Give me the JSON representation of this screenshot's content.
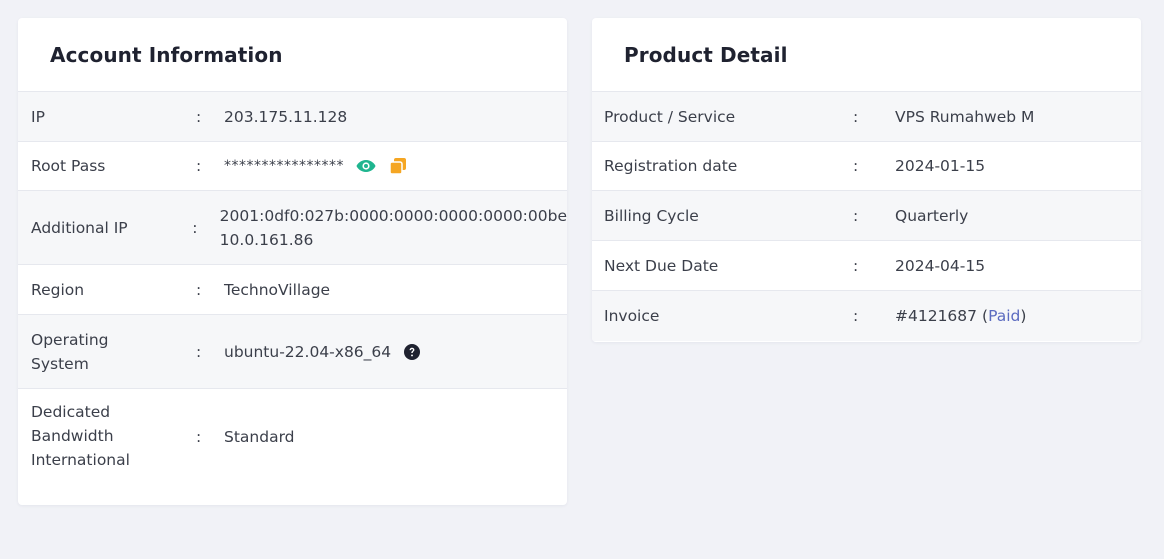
{
  "account": {
    "title": "Account Information",
    "rows": [
      {
        "label": "IP",
        "value": "203.175.11.128"
      },
      {
        "label": "Root Pass",
        "value": "****************"
      },
      {
        "label": "Additional IP",
        "value_lines": [
          "2001:0df0:027b:0000:0000:0000:0000:00be",
          "10.0.161.86"
        ]
      },
      {
        "label": "Region",
        "value": "TechnoVillage"
      },
      {
        "label_lines": [
          "Operating",
          "System"
        ],
        "value": "ubuntu-22.04-x86_64"
      },
      {
        "label_lines": [
          "Dedicated",
          "Bandwidth",
          "International"
        ],
        "value": "Standard"
      }
    ],
    "separator": ":",
    "icons": {
      "show_password": "eye-icon",
      "copy_password": "copy-icon",
      "os_help": "question-circle-icon"
    }
  },
  "product": {
    "title": "Product Detail",
    "rows": [
      {
        "label": "Product / Service",
        "value": "VPS Rumahweb M"
      },
      {
        "label": "Registration date",
        "value": "2024-01-15"
      },
      {
        "label": "Billing Cycle",
        "value": "Quarterly"
      },
      {
        "label": "Next Due Date",
        "value": "2024-04-15"
      },
      {
        "label": "Invoice",
        "invoice_number": "#4121687",
        "invoice_status": "Paid",
        "paren_open": "(",
        "paren_close": ")"
      }
    ],
    "separator": ":"
  },
  "colors": {
    "page_bg": "#f1f2f7",
    "eye_icon": "#1fb58f",
    "copy_icon": "#f5a623",
    "link": "#5b6bc0"
  }
}
